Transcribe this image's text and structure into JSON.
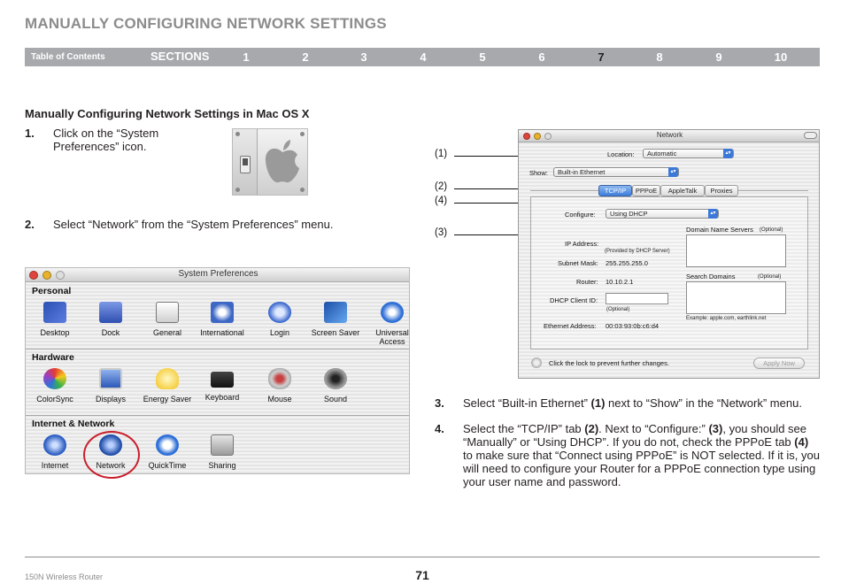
{
  "header": {
    "title": "MANUALLY CONFIGURING NETWORK SETTINGS"
  },
  "nav": {
    "toc_label": "Table of Contents",
    "sections_label": "SECTIONS",
    "numbers": [
      "1",
      "2",
      "3",
      "4",
      "5",
      "6",
      "7",
      "8",
      "9",
      "10"
    ],
    "active": "7",
    "bar_color": "#a7a9ac"
  },
  "content": {
    "heading": "Manually Configuring Network Settings in Mac OS X",
    "steps": [
      {
        "num": "1.",
        "line1": "Click on the “System",
        "line2": "Preferences” icon."
      },
      {
        "num": "2.",
        "text": "Select “Network” from the “System Preferences” menu."
      },
      {
        "num": "3.",
        "pre": "Select “Built-in Ethernet” ",
        "bold": "(1)",
        "post": " next to “Show” in the “Network” menu."
      },
      {
        "num": "4.",
        "l1a": "Select the “TCP/IP” tab ",
        "l1b": "(2)",
        "l1c": ". Next to “Configure:” ",
        "l1d": "(3)",
        "l1e": ", you should see",
        "l2a": "“Manually” or “Using DHCP”. If you do not, check the PPPoE tab ",
        "l2b": "(4)",
        "l3": "to make sure that “Connect using PPPoE” is NOT selected. If it is, you",
        "l4": "will need to configure your Router for a PPPoE connection type using",
        "l5": "your user name and password."
      }
    ]
  },
  "sysprefs_window": {
    "title": "System Preferences",
    "categories": [
      {
        "name": "Personal",
        "items": [
          "Desktop",
          "Dock",
          "General",
          "International",
          "Login",
          "Screen Saver",
          "Universal Access"
        ]
      },
      {
        "name": "Hardware",
        "items": [
          "ColorSync",
          "Displays",
          "Energy Saver",
          "Keyboard",
          "Mouse",
          "Sound"
        ]
      },
      {
        "name": "Internet & Network",
        "items": [
          "Internet",
          "Network",
          "QuickTime",
          "Sharing"
        ]
      }
    ],
    "highlighted": "Network",
    "highlight_color": "#c8202e"
  },
  "network_window": {
    "title": "Network",
    "location_label": "Location:",
    "location_value": "Automatic",
    "show_label": "Show:",
    "show_value": "Built-in Ethernet",
    "tabs": [
      "TCP/IP",
      "PPPoE",
      "AppleTalk",
      "Proxies"
    ],
    "selected_tab": "TCP/IP",
    "configure_label": "Configure:",
    "configure_value": "Using DHCP",
    "dns_label": "Domain Name Servers",
    "dns_optional": "(Optional)",
    "ip_label": "IP Address:",
    "ip_note": "(Provided by DHCP Server)",
    "subnet_label": "Subnet Mask:",
    "subnet_value": "255.255.255.0",
    "router_label": "Router:",
    "router_value": "10.10.2.1",
    "search_label": "Search Domains",
    "search_optional": "(Optional)",
    "dhcp_label": "DHCP Client ID:",
    "dhcp_optional": "(Optional)",
    "example": "Example: apple.com, earthlink.net",
    "ethernet_label": "Ethernet Address:",
    "ethernet_value": "00:03:93:0b:c6:d4",
    "lock_text": "Click the lock to prevent further changes.",
    "apply_label": "Apply Now"
  },
  "callouts": [
    "(1)",
    "(2)",
    "(4)",
    "(3)"
  ],
  "footer": {
    "product": "150N Wireless Router",
    "page": "71"
  }
}
